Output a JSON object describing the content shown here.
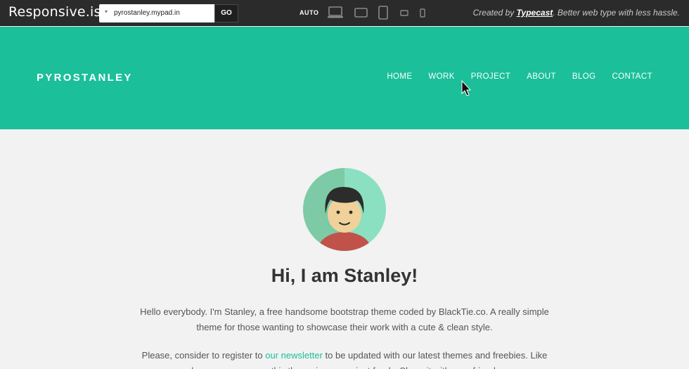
{
  "toolbar": {
    "brand": "Responsive.is/",
    "url_value": "pyrostanley.mypad.in",
    "go_label": "GO",
    "auto_label": "AUTO",
    "devices": [
      "desktop-icon",
      "laptop-icon",
      "tablet-portrait-icon",
      "phone-landscape-icon",
      "phone-portrait-icon"
    ],
    "credit_prefix": "Created by ",
    "credit_link": "Typecast",
    "credit_suffix": ". Better web type with less hassle."
  },
  "site": {
    "logo": "PYROSTANLEY",
    "nav": [
      "HOME",
      "WORK",
      "PROJECT",
      "ABOUT",
      "BLOG",
      "CONTACT"
    ],
    "accent_color": "#1bbf99"
  },
  "main": {
    "title": "Hi, I am Stanley!",
    "intro": "Hello everybody. I'm Stanley, a free handsome bootstrap theme coded by BlackTie.co. A really simple theme for those wanting to showcase their work with a cute & clean style.",
    "register_prefix": "Please, consider to register to ",
    "register_link": "our newsletter",
    "register_suffix": " to be updated with our latest themes and freebies. Like always, you can use this theme in any project freely. Share it with your friends."
  }
}
